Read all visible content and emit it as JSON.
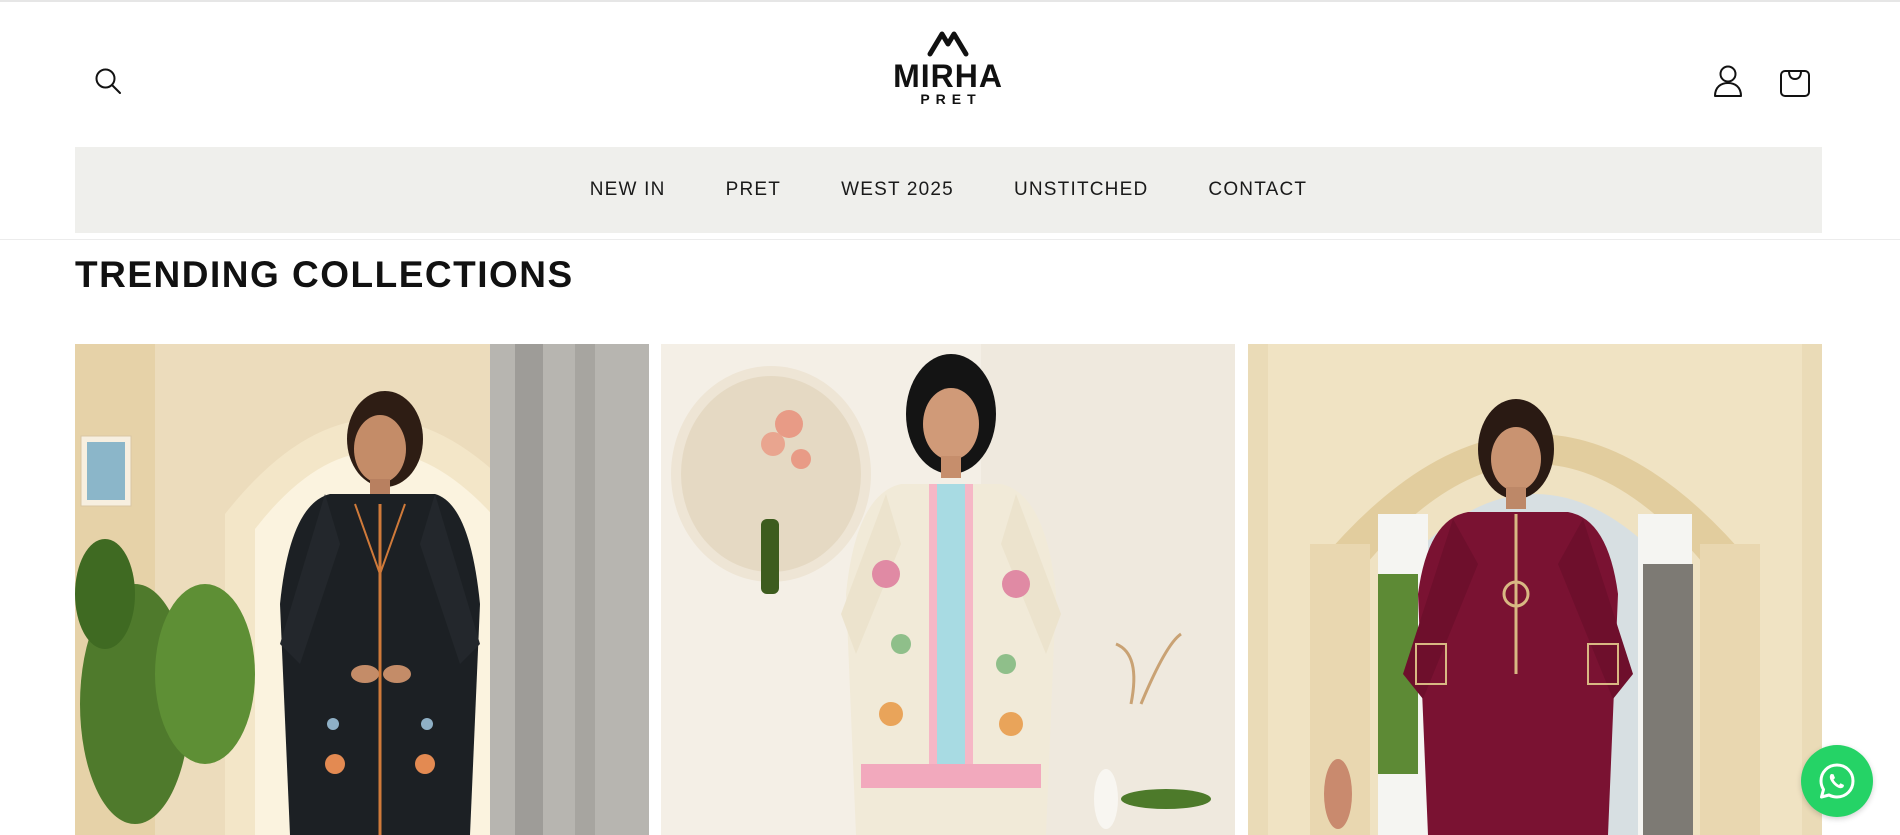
{
  "header": {
    "brand": {
      "name": "MIRHA",
      "sub": "PRET"
    },
    "icons": {
      "search": "search-icon",
      "account": "account-icon",
      "cart": "cart-icon"
    }
  },
  "nav": {
    "items": [
      {
        "label": "NEW IN"
      },
      {
        "label": "PRET"
      },
      {
        "label": "WEST 2025"
      },
      {
        "label": "UNSTITCHED"
      },
      {
        "label": "CONTACT"
      }
    ]
  },
  "section": {
    "title": "TRENDING COLLECTIONS"
  },
  "collections": [
    {
      "image": "product-image-black-embroidered-suit",
      "outfit_color": "#1c2024"
    },
    {
      "image": "product-image-printed-cream-suit",
      "outfit_color": "#f1ead8"
    },
    {
      "image": "product-image-maroon-embroidered-suit",
      "outfit_color": "#7a1232"
    }
  ],
  "floating": {
    "whatsapp_icon": "whatsapp-icon",
    "color": "#25d366"
  },
  "colors": {
    "nav_bg": "#efefec",
    "text": "#121212"
  }
}
